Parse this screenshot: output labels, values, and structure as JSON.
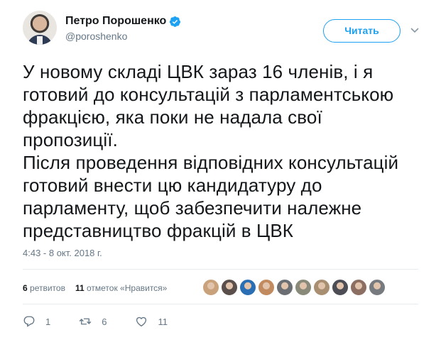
{
  "user": {
    "display_name": "Петро Порошенко",
    "handle": "@poroshenko",
    "verified": true
  },
  "follow_label": "Читать",
  "tweet": {
    "lines": [
      "У новому складі ЦВК зараз 16 членів, і я",
      "готовий до консультацій з парламентською",
      "фракцією, яка поки не надала свої",
      "пропозиції.",
      "Після проведення відповідних консультацій",
      "готовий внести цю кандидатуру до",
      "парламенту, щоб забезпечити належне",
      "представництво фракцій в ЦВК"
    ]
  },
  "timestamp": "4:43 - 8 окт. 2018 г.",
  "stats": {
    "retweets_count": "6",
    "retweets_label": "ретвитов",
    "likes_count": "11",
    "likes_label": "отметок «Нравится»"
  },
  "liker_avatar_colors": [
    "#c9a27c",
    "#5a4f4a",
    "#2a6fb3",
    "#c28b5f",
    "#6b6f74",
    "#8a8a7a",
    "#a98f72",
    "#4d4d55",
    "#8c6f62",
    "#777b80"
  ],
  "actions": {
    "reply_count": "1",
    "retweet_count": "6",
    "like_count": "11"
  },
  "colors": {
    "accent": "#1da1f2",
    "text": "#14171a",
    "secondary": "#657786",
    "divider": "#e6ecf0"
  }
}
